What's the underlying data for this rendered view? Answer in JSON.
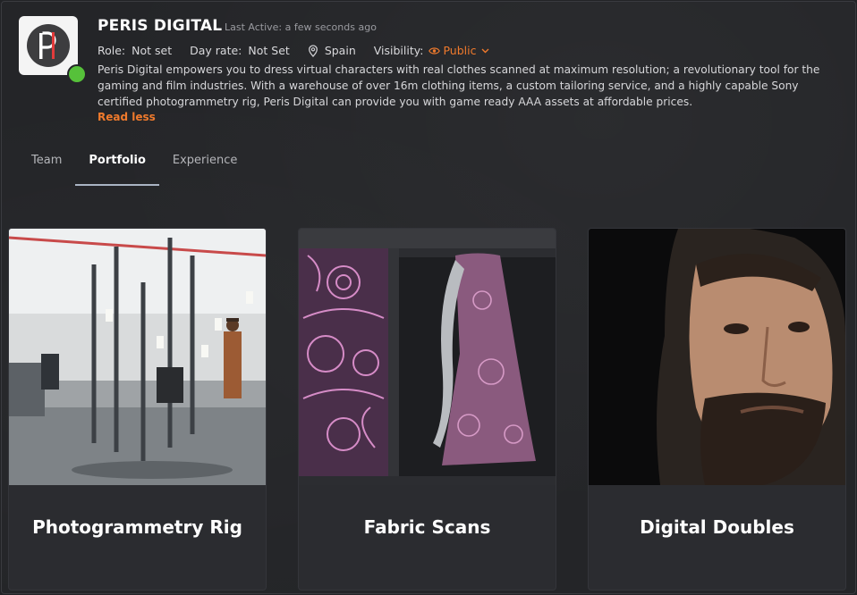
{
  "profile": {
    "name": "PERIS DIGITAL",
    "last_active": "Last Active: a few seconds ago",
    "role_label": "Role:",
    "role_value": "Not set",
    "day_rate_label": "Day rate:",
    "day_rate_value": "Not Set",
    "location": "Spain",
    "visibility_label": "Visibility:",
    "visibility_value": "Public",
    "description": "Peris Digital empowers you to dress virtual characters with real clothes scanned at maximum resolution; a revolutionary tool for the gaming and film industries. With a warehouse of over 16m clothing items, a custom tailoring service, and a highly capable Sony certified photogrammetry rig, Peris Digital can provide you with game ready AAA assets at affordable prices.",
    "read_less": "Read less"
  },
  "tabs": [
    {
      "label": "Team"
    },
    {
      "label": "Portfolio"
    },
    {
      "label": "Experience"
    }
  ],
  "portfolio": [
    {
      "title": "Photogrammetry Rig"
    },
    {
      "title": "Fabric Scans"
    },
    {
      "title": "Digital Doubles"
    }
  ],
  "colors": {
    "accent": "#f07a2c",
    "online": "#56c13a",
    "background": "#242528",
    "card": "#2b2c30"
  },
  "icons": [
    "map-pin-icon",
    "eye-icon",
    "chevron-down-icon"
  ]
}
